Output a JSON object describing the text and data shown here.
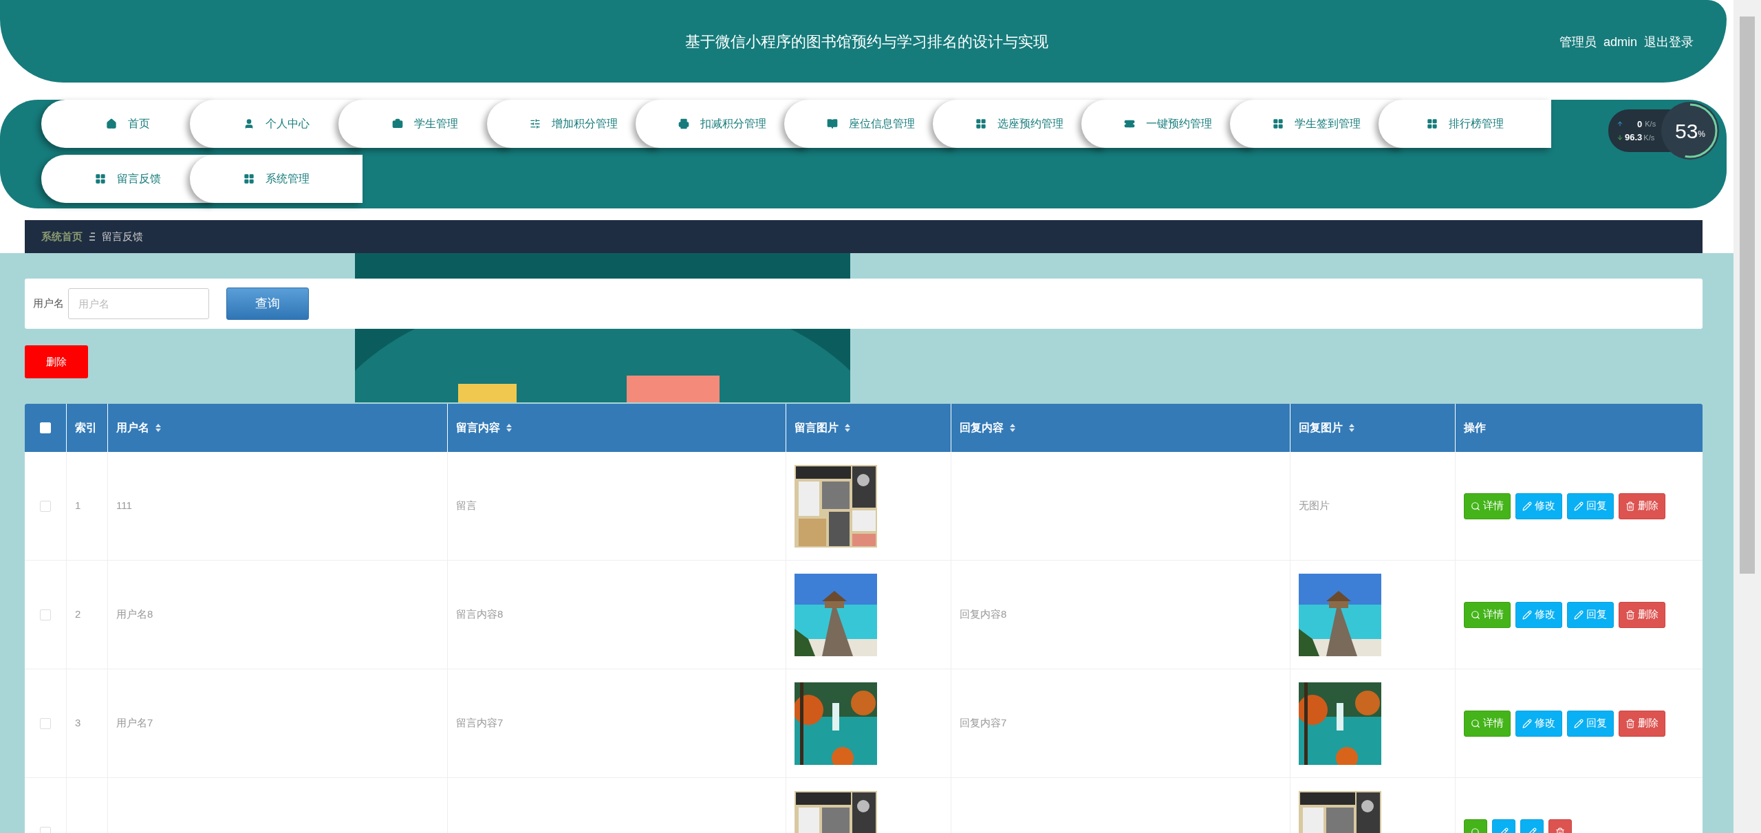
{
  "header": {
    "title": "基于微信小程序的图书馆预约与学习排名的设计与实现",
    "role": "管理员",
    "user": "admin",
    "logout": "退出登录"
  },
  "nav": [
    {
      "label": "首页"
    },
    {
      "label": "个人中心"
    },
    {
      "label": "学生管理"
    },
    {
      "label": "增加积分管理"
    },
    {
      "label": "扣减积分管理"
    },
    {
      "label": "座位信息管理"
    },
    {
      "label": "选座预约管理"
    },
    {
      "label": "一键预约管理"
    },
    {
      "label": "学生签到管理"
    },
    {
      "label": "排行榜管理"
    },
    {
      "label": "留言反馈"
    },
    {
      "label": "系统管理"
    }
  ],
  "net_meter": {
    "upload": "0",
    "upload_unit": "K/s",
    "download": "96.3",
    "download_unit": "K/s",
    "percent": "53",
    "percent_unit": "%",
    "level": 0.53
  },
  "breadcrumb": [
    "系统首页",
    "留言反馈"
  ],
  "search": {
    "label": "用户名",
    "placeholder": "用户名",
    "button": "查询"
  },
  "delete_button": "删除",
  "table": {
    "select_all": {
      "checked": false
    },
    "columns": [
      {
        "label": "索引",
        "sortable": false
      },
      {
        "label": "用户名",
        "sortable": true
      },
      {
        "label": "留言内容",
        "sortable": true
      },
      {
        "label": "留言图片",
        "sortable": true
      },
      {
        "label": "回复内容",
        "sortable": true
      },
      {
        "label": "回复图片",
        "sortable": true
      },
      {
        "label": "操作",
        "sortable": false
      }
    ],
    "rows": [
      {
        "checked": false,
        "index": "1",
        "username": "111",
        "message": "留言",
        "reply_image": {
          "kind": "text",
          "text": "无图片"
        },
        "actions": [
          {
            "kind": "detail",
            "label": "详情"
          },
          {
            "kind": "edit",
            "label": "修改"
          },
          {
            "kind": "reply",
            "label": "回复"
          },
          {
            "kind": "delete",
            "label": "删除"
          }
        ]
      },
      {
        "checked": false,
        "index": "2",
        "username": "用户名8",
        "message": "留言内容8",
        "reply": "回复内容8",
        "actions": [
          {
            "kind": "detail",
            "label": "详情"
          },
          {
            "kind": "edit",
            "label": "修改"
          },
          {
            "kind": "reply",
            "label": "回复"
          },
          {
            "kind": "delete",
            "label": "删除"
          }
        ]
      },
      {
        "checked": false,
        "index": "3",
        "username": "用户名7",
        "message": "留言内容7",
        "reply": "回复内容7",
        "actions": [
          {
            "kind": "detail",
            "label": "详情"
          },
          {
            "kind": "edit",
            "label": "修改"
          },
          {
            "kind": "reply",
            "label": "回复"
          },
          {
            "kind": "delete",
            "label": "删除"
          }
        ]
      },
      {
        "checked": false,
        "actions": [
          {
            "kind": "detail"
          },
          {
            "kind": "edit"
          },
          {
            "kind": "reply"
          },
          {
            "kind": "delete"
          }
        ]
      }
    ]
  }
}
